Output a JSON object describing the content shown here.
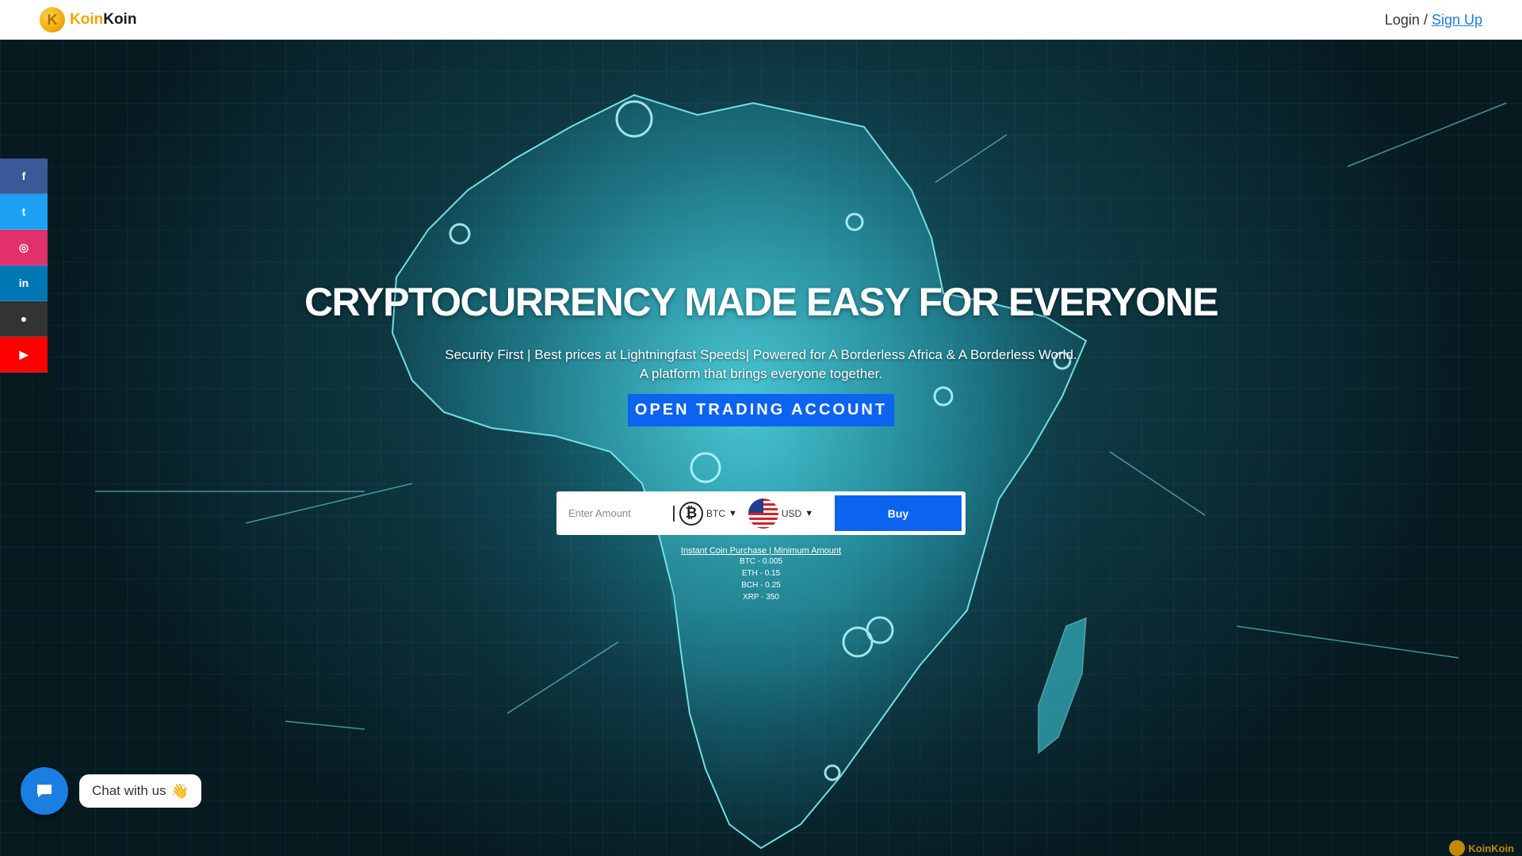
{
  "header": {
    "brand_mark": "K",
    "brand_part1": "Koin",
    "brand_part2": "Koin",
    "login_label": "Login",
    "separator": " / ",
    "signup_label": "Sign Up"
  },
  "social": [
    {
      "icon": "facebook-icon",
      "glyph": "f",
      "color": "#3b5998"
    },
    {
      "icon": "twitter-icon",
      "glyph": "t",
      "color": "#1da1f2"
    },
    {
      "icon": "instagram-icon",
      "glyph": "◎",
      "color": "#e1306c"
    },
    {
      "icon": "linkedin-icon",
      "glyph": "in",
      "color": "#0077b5"
    },
    {
      "icon": "github-icon",
      "glyph": "●",
      "color": "#333333"
    },
    {
      "icon": "youtube-icon",
      "glyph": "▶",
      "color": "#ff0000"
    }
  ],
  "hero": {
    "headline": "CRYPTOCURRENCY MADE EASY FOR EVERYONE",
    "subtitle_line1": "Security First | Best prices at Lightningfast Speeds| Powered for A Borderless Africa & A Borderless World.",
    "subtitle_line2": "A platform that brings everyone together.",
    "cta_label": "OPEN TRADING ACCOUNT"
  },
  "widget": {
    "amount_placeholder": "Enter Amount",
    "coin_symbol": "₿",
    "coin_value": "BTC",
    "fiat_value": "USD",
    "buy_label": "Buy"
  },
  "minimums": {
    "title": "Instant Coin Purchase | Minimum Amount",
    "lines": [
      "BTC - 0.005",
      "ETH - 0.15",
      "BCH - 0.25",
      "XRP - 350"
    ]
  },
  "chat": {
    "label": "Chat with us",
    "emoji": "👋"
  },
  "watermark": {
    "label": "KoinKoin"
  },
  "colors": {
    "accent": "#0b63f0",
    "brand": "#f0a500",
    "link": "#1e7be6"
  }
}
